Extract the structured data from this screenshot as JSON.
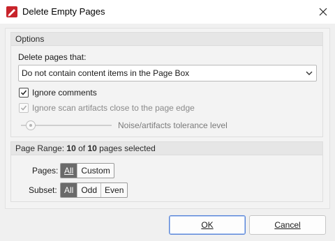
{
  "window": {
    "title": "Delete Empty Pages",
    "icon": "pdf-editor-app-icon",
    "close_icon": "close-icon"
  },
  "options": {
    "header": "Options",
    "delete_label": "Delete pages that:",
    "condition_selected": "Do not contain content items in the Page Box",
    "ignore_comments": {
      "label": "Ignore comments",
      "checked": true,
      "enabled": true
    },
    "ignore_scan": {
      "label": "Ignore scan artifacts close to the page edge",
      "checked": true,
      "enabled": false
    },
    "tolerance": {
      "label": "Noise/artifacts tolerance level",
      "enabled": false
    }
  },
  "page_range": {
    "header_prefix": "Page Range: ",
    "selected": "10",
    "of_text": " of ",
    "total": "10",
    "suffix": " pages selected",
    "pages_label": "Pages:",
    "pages_options": [
      "All",
      "Custom"
    ],
    "pages_selected": "All",
    "subset_label": "Subset:",
    "subset_options": [
      "All",
      "Odd",
      "Even"
    ],
    "subset_selected": "All"
  },
  "buttons": {
    "ok": "OK",
    "cancel": "Cancel"
  },
  "colors": {
    "accent": "#5b86d8",
    "selected_segment": "#6a6a6a",
    "app_icon": "#c8242b"
  }
}
